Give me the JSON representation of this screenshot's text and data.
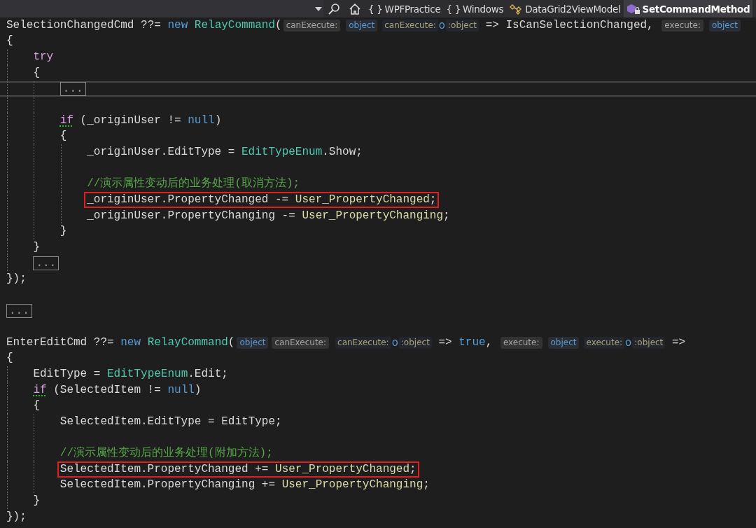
{
  "toolbar": {
    "breadcrumbs": [
      {
        "kind": "namespace",
        "glyph": "{ }",
        "label": "WPFPractice",
        "selected": false
      },
      {
        "kind": "namespace",
        "glyph": "{ }",
        "label": "Windows",
        "selected": false
      },
      {
        "kind": "class",
        "label": "DataGrid2ViewModel",
        "selected": false
      },
      {
        "kind": "method",
        "label": "SetCommandMethod",
        "selected": true
      }
    ]
  },
  "editor": {
    "lines": [
      {
        "kind": "code",
        "tokens": [
          {
            "kind": "plain",
            "text": "SelectionChangedCmd ??= "
          },
          {
            "kind": "keyword",
            "text": "new "
          },
          {
            "kind": "type",
            "text": "RelayCommand"
          },
          {
            "kind": "plain",
            "text": "("
          },
          {
            "kind": "hint-label",
            "text": "canExecute:"
          },
          {
            "kind": "hint-type",
            "text": "object"
          },
          {
            "kind": "hint-param",
            "text": "canExecute:"
          },
          {
            "kind": "hint-var",
            "text": "o"
          },
          {
            "kind": "hint-ptype",
            "text": ":object"
          },
          {
            "kind": "plain",
            "text": " => IsCanSelectionChanged, "
          },
          {
            "kind": "hint-label",
            "text": "execute:"
          },
          {
            "kind": "hint-type",
            "text": "object"
          }
        ]
      },
      {
        "kind": "code",
        "tokens": [
          {
            "kind": "plain",
            "text": "{"
          }
        ]
      },
      {
        "kind": "code",
        "tokens": [
          {
            "kind": "control",
            "text": "    try",
            "squiggle": false
          }
        ]
      },
      {
        "kind": "code",
        "tokens": [
          {
            "kind": "plain",
            "text": "    {"
          }
        ]
      },
      {
        "kind": "code",
        "current": true,
        "tokens": [
          {
            "kind": "collapsed",
            "text": "        ..."
          }
        ]
      },
      {
        "kind": "blank"
      },
      {
        "kind": "code",
        "tokens": [
          {
            "kind": "control",
            "text": "        if",
            "squiggle": true
          },
          {
            "kind": "plain",
            "text": " (_originUser != "
          },
          {
            "kind": "keyword",
            "text": "null"
          },
          {
            "kind": "plain",
            "text": ")"
          }
        ]
      },
      {
        "kind": "code",
        "tokens": [
          {
            "kind": "plain",
            "text": "        {"
          }
        ]
      },
      {
        "kind": "code",
        "tokens": [
          {
            "kind": "plain",
            "text": "            _originUser.EditType = "
          },
          {
            "kind": "type",
            "text": "EditTypeEnum"
          },
          {
            "kind": "plain",
            "text": ".Show;"
          }
        ]
      },
      {
        "kind": "blank"
      },
      {
        "kind": "code",
        "tokens": [
          {
            "kind": "comment",
            "text": "            //演示属性变动后的业务处理(取消方法);"
          }
        ]
      },
      {
        "kind": "code",
        "boxed": true,
        "tokens": [
          {
            "kind": "plain",
            "text": "            _originUser.PropertyChanged -= "
          },
          {
            "kind": "method",
            "text": "User_PropertyChanged"
          },
          {
            "kind": "plain",
            "text": ";"
          }
        ]
      },
      {
        "kind": "code",
        "tokens": [
          {
            "kind": "plain",
            "text": "            _originUser.PropertyChanging -= "
          },
          {
            "kind": "method",
            "text": "User_PropertyChanging"
          },
          {
            "kind": "plain",
            "text": ";"
          }
        ]
      },
      {
        "kind": "code",
        "tokens": [
          {
            "kind": "plain",
            "text": "        }"
          }
        ]
      },
      {
        "kind": "code",
        "tokens": [
          {
            "kind": "plain",
            "text": "    }"
          }
        ]
      },
      {
        "kind": "code",
        "tokens": [
          {
            "kind": "collapsed",
            "text": "    ..."
          }
        ]
      },
      {
        "kind": "code",
        "tokens": [
          {
            "kind": "plain",
            "text": "});"
          }
        ]
      },
      {
        "kind": "blank"
      },
      {
        "kind": "code",
        "tokens": [
          {
            "kind": "collapsed",
            "text": "..."
          }
        ]
      },
      {
        "kind": "blank"
      },
      {
        "kind": "code",
        "tokens": [
          {
            "kind": "plain",
            "text": "EnterEditCmd ??= "
          },
          {
            "kind": "keyword",
            "text": "new "
          },
          {
            "kind": "type",
            "text": "RelayCommand"
          },
          {
            "kind": "plain",
            "text": "("
          },
          {
            "kind": "hint-type",
            "text": "object"
          },
          {
            "kind": "hint-label",
            "text": "canExecute:"
          },
          {
            "kind": "hint-param",
            "text": "canExecute:"
          },
          {
            "kind": "hint-var",
            "text": "o"
          },
          {
            "kind": "hint-ptype",
            "text": ":object"
          },
          {
            "kind": "plain",
            "text": " => "
          },
          {
            "kind": "keyword",
            "text": "true"
          },
          {
            "kind": "plain",
            "text": ", "
          },
          {
            "kind": "hint-label",
            "text": "execute:"
          },
          {
            "kind": "hint-type",
            "text": "object"
          },
          {
            "kind": "hint-param",
            "text": "execute:"
          },
          {
            "kind": "hint-var",
            "text": "o"
          },
          {
            "kind": "hint-ptype",
            "text": ":object"
          },
          {
            "kind": "plain",
            "text": " =>"
          }
        ]
      },
      {
        "kind": "code",
        "tokens": [
          {
            "kind": "plain",
            "text": "{"
          }
        ]
      },
      {
        "kind": "code",
        "tokens": [
          {
            "kind": "plain",
            "text": "    EditType = "
          },
          {
            "kind": "type",
            "text": "EditTypeEnum"
          },
          {
            "kind": "plain",
            "text": ".Edit;"
          }
        ]
      },
      {
        "kind": "code",
        "tokens": [
          {
            "kind": "control",
            "text": "    if",
            "squiggle": true
          },
          {
            "kind": "plain",
            "text": " (SelectedItem != "
          },
          {
            "kind": "keyword",
            "text": "null"
          },
          {
            "kind": "plain",
            "text": ")"
          }
        ]
      },
      {
        "kind": "code",
        "tokens": [
          {
            "kind": "plain",
            "text": "    {"
          }
        ]
      },
      {
        "kind": "code",
        "tokens": [
          {
            "kind": "plain",
            "text": "        SelectedItem.EditType = EditType;"
          }
        ]
      },
      {
        "kind": "blank"
      },
      {
        "kind": "code",
        "tokens": [
          {
            "kind": "comment",
            "text": "        //演示属性变动后的业务处理(附加方法);"
          }
        ]
      },
      {
        "kind": "code",
        "boxed": true,
        "tokens": [
          {
            "kind": "plain",
            "text": "        SelectedItem.PropertyChanged += "
          },
          {
            "kind": "method",
            "text": "User_PropertyChanged"
          },
          {
            "kind": "plain",
            "text": ";"
          }
        ]
      },
      {
        "kind": "code",
        "tokens": [
          {
            "kind": "plain",
            "text": "        SelectedItem.PropertyChanging += "
          },
          {
            "kind": "method",
            "text": "User_PropertyChanging"
          },
          {
            "kind": "plain",
            "text": ";"
          }
        ]
      },
      {
        "kind": "code",
        "tokens": [
          {
            "kind": "plain",
            "text": "    }"
          }
        ]
      },
      {
        "kind": "code",
        "tokens": [
          {
            "kind": "plain",
            "text": "});"
          }
        ]
      }
    ]
  }
}
